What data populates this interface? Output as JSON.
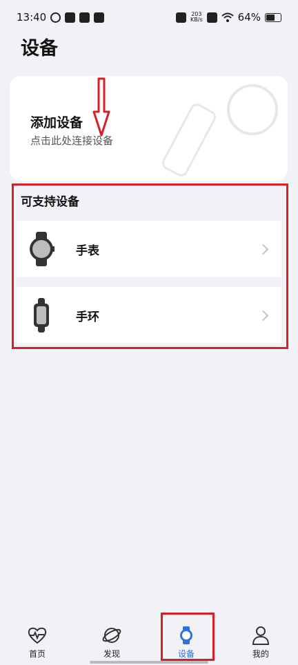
{
  "status_bar": {
    "time": "13:40",
    "net_speed_value": "203",
    "net_speed_unit": "KB/s",
    "battery": "64%"
  },
  "page": {
    "title": "设备"
  },
  "add_device": {
    "title": "添加设备",
    "subtitle": "点击此处连接设备"
  },
  "supported": {
    "title": "可支持设备",
    "items": [
      {
        "label": "手表",
        "icon": "watch-icon"
      },
      {
        "label": "手环",
        "icon": "band-icon"
      }
    ]
  },
  "bottom_nav": {
    "items": [
      {
        "label": "首页",
        "icon": "heart-pulse-icon"
      },
      {
        "label": "发现",
        "icon": "planet-icon"
      },
      {
        "label": "设备",
        "icon": "watch-icon",
        "active": true
      },
      {
        "label": "我的",
        "icon": "person-icon"
      }
    ]
  },
  "colors": {
    "accent": "#2f6fe0",
    "annotation_red": "#d81f26",
    "background": "#f1f2f6"
  }
}
